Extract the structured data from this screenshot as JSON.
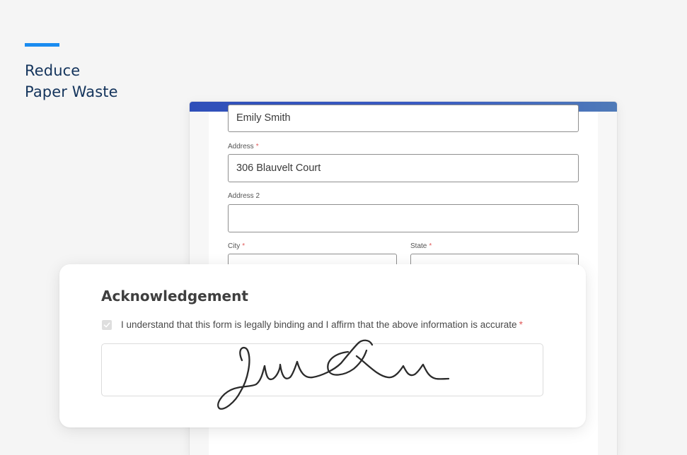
{
  "hero": {
    "title_line1": "Reduce",
    "title_line2": "Paper Waste"
  },
  "form": {
    "name_value": "Emily Smith",
    "address_label": "Address",
    "address_value": "306 Blauvelt Court",
    "address2_label": "Address 2",
    "address2_value": "",
    "city_label": "City",
    "state_label": "State",
    "required_mark": "*"
  },
  "acknowledgement": {
    "title": "Acknowledgement",
    "checkbox_checked": true,
    "statement": "I understand that this form is legally binding and I affirm that the above information is accurate",
    "required_mark": "*"
  },
  "colors": {
    "accent": "#1a8cf0",
    "heading": "#14345c",
    "header_gradient_start": "#2f4fb9",
    "header_gradient_end": "#4f7ab8",
    "required": "#e05b5b"
  },
  "icons": {
    "checkbox": "checkmark-icon",
    "signature": "handwritten-signature"
  }
}
